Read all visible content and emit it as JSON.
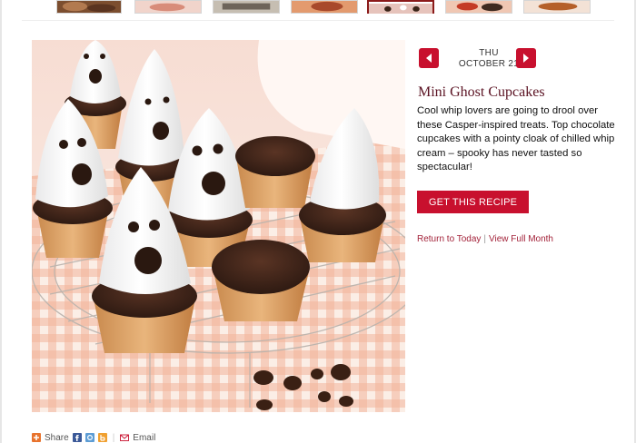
{
  "thumbnails": [
    {
      "label": "thumb-1",
      "color": "#8c5b3a"
    },
    {
      "label": "thumb-2",
      "color": "#e7b7a9"
    },
    {
      "label": "thumb-3",
      "color": "#a79b8c"
    },
    {
      "label": "thumb-4",
      "color": "#d87d4e"
    },
    {
      "label": "thumb-5",
      "color": "#b9a7a4"
    },
    {
      "label": "thumb-6",
      "color": "#c8412c"
    },
    {
      "label": "thumb-7",
      "color": "#b5602a"
    }
  ],
  "calendar": {
    "day": "THU",
    "date": "OCTOBER 21",
    "prev_icon": "chevron-left-icon",
    "next_icon": "chevron-right-icon"
  },
  "recipe": {
    "title": "Mini Ghost Cupcakes",
    "description": "Cool whip lovers are going to drool over these Casper-inspired treats. Top chocolate cupcakes with a pointy cloak of chilled whip cream – spooky has never tasted so spectacular!",
    "cta_label": "GET THIS RECIPE"
  },
  "links": {
    "return_today": "Return to Today",
    "separator": "|",
    "view_month": "View Full Month"
  },
  "share": {
    "share_label": "Share",
    "email_label": "Email",
    "icons": [
      "share-plus-icon",
      "facebook-icon",
      "stumbleupon-icon",
      "bookmark-icon",
      "email-icon"
    ]
  },
  "colors": {
    "accent": "#c8102e",
    "title": "#5a1222",
    "link": "#a3233a"
  }
}
